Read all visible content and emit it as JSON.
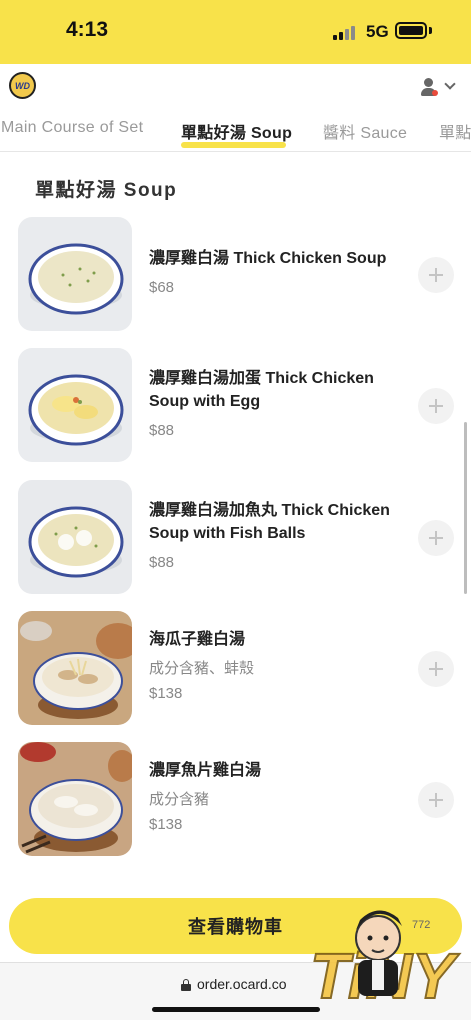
{
  "status_bar": {
    "time": "4:13",
    "network": "5G"
  },
  "header": {
    "logo_text": "WD",
    "logo_color": "#f2c94c"
  },
  "tabs": [
    {
      "label": "Main Course of Set",
      "active": false
    },
    {
      "label": "單點好湯 Soup",
      "active": true
    },
    {
      "label": "醬料 Sauce",
      "active": false
    },
    {
      "label": "單點",
      "active": false
    }
  ],
  "section": {
    "title": "單點好湯 Soup"
  },
  "items": [
    {
      "name": "濃厚雞白湯 Thick Chicken Soup",
      "desc": "",
      "price": "$68"
    },
    {
      "name": "濃厚雞白湯加蛋 Thick Chicken Soup with Egg",
      "desc": "",
      "price": "$88"
    },
    {
      "name": "濃厚雞白湯加魚丸 Thick Chicken Soup with Fish Balls",
      "desc": "",
      "price": "$88"
    },
    {
      "name": "海瓜子雞白湯",
      "desc": "成分含豬、蚌殼",
      "price": "$138"
    },
    {
      "name": "濃厚魚片雞白湯",
      "desc": "成分含豬",
      "price": "$138"
    }
  ],
  "cart": {
    "label": "查看購物車",
    "count": "772"
  },
  "browser": {
    "url": "order.ocard.co"
  },
  "watermark": {
    "text": "TiNY"
  },
  "colors": {
    "accent": "#f8e24a",
    "text_primary": "#222222",
    "text_secondary": "#888888"
  }
}
